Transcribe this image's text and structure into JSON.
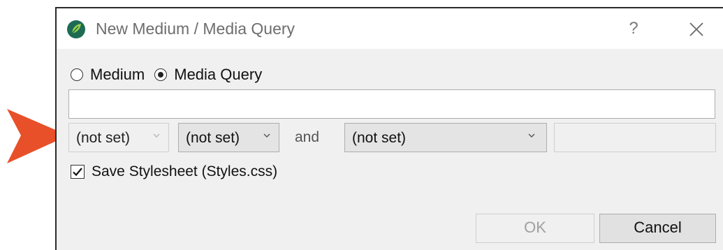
{
  "window": {
    "title": "New Medium / Media Query",
    "help_label": "?",
    "app_icon": "madcap-leaf-icon",
    "close_icon": "close-icon"
  },
  "mode": {
    "options": [
      {
        "label": "Medium",
        "selected": false
      },
      {
        "label": "Media Query",
        "selected": true
      }
    ]
  },
  "query": {
    "value": ""
  },
  "builder": {
    "modifier": {
      "value": "(not set)",
      "enabled": false
    },
    "media_type": {
      "value": "(not set)",
      "enabled": true
    },
    "and_label": "and",
    "feature": {
      "value": "(not set)",
      "enabled": true
    },
    "feature_value": {
      "value": "",
      "enabled": false
    }
  },
  "save_stylesheet": {
    "label": "Save Stylesheet (Styles.css)",
    "checked": true
  },
  "buttons": {
    "ok_label": "OK",
    "ok_enabled": false,
    "cancel_label": "Cancel"
  },
  "callout": {
    "icon": "arrow-pointer-icon",
    "color": "#e8502a"
  }
}
